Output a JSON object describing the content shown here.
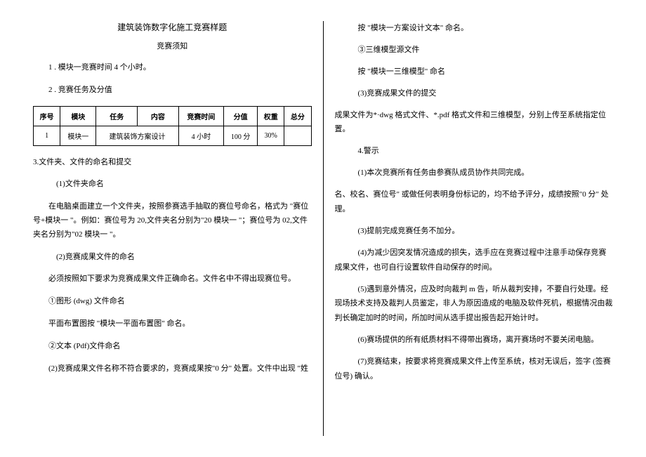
{
  "left": {
    "title": "建筑装饰数字化施工竞赛样题",
    "subtitle": "竞赛须知",
    "item1": "1 . 模块一竞赛时间 4 个小时。",
    "item2": "2  . 竞赛任务及分值",
    "table": {
      "headers": [
        "序号",
        "模块",
        "任务",
        "内容",
        "竞赛时间",
        "分值",
        "权重",
        "总分"
      ],
      "row": [
        "1",
        "模块一",
        "建筑装饰方案设计",
        "",
        "4 小时",
        "100 分",
        "30%",
        ""
      ]
    },
    "item3": "3.文件夹、文件的命名和提交",
    "sub3_1": "(1)文件夹命名",
    "p3_1": "在电脑桌面建立一个文件夹，按照参赛选手抽取的赛位号命名，格式为 \"赛位号+模块一 \"。例如：赛位号为 20,文件夹名分别为\"20 模块一 \"；赛位号为 02,文件夹名分别为\"02 模块一 \"。",
    "sub3_2": "(2)竞赛成果文件的命名",
    "p3_2a": "必须按照如下要求为竞赛成果文件正确命名。文件名中不得出现赛位号。",
    "p3_2b": "①图形 (dwg) 文件命名",
    "p3_2c": "平面布置图按 \"模块一平面布置图\" 命名。",
    "p3_2d": "②文本 (Pdf)文件命名",
    "p3_2e": "(2)竞赛成果文件名称不符合要求的，竞赛成果按\"0 分\" 处置。文件中出现 \"姓"
  },
  "right": {
    "r1": "按 \"模块一方案设计文本\" 命名。",
    "r2": "③三维模型源文件",
    "r3": "按 \"模块一三维模型\" 命名",
    "r4": "(3)竞赛成果文件的提交",
    "r5": "成果文件为*·dwg 格式文件、*.pdf 格式文件和三维模型，分别上传至系统指定位置。",
    "r6": "4.警示",
    "r7": "(1)本次竞赛所有任务由参赛队成员协作共同完成。",
    "r8": "名、校名、赛位号\" 或做任何表明身份标记的，均不给予评分，成绩按照\"0 分\" 处理。",
    "r9": "(3)提前完成竞赛任务不加分。",
    "r10": "(4)为减少因突发情况造成的损失，选手应在竞赛过程中注意手动保存竞赛成果文件，也可自行设置软件自动保存的时间。",
    "r11": "(5)遇到意外情况，应及时向裁判 m 告，听从裁判安排，不要自行处理。经现场技术支持及裁判人员鉴定，非人为原因造成的电脑及软件死机，根据情况由裁判长确定加时的时间，所加时间从选手提出报告起开始计时。",
    "r12": "(6)赛场提供的所有纸质材料不得带出赛场，离开赛场时不要关闭电脑。",
    "r13": "(7)竞赛结束，按要求将竞赛成果文件上传至系统，核对无误后，签字 (签赛位号) 确认。"
  }
}
